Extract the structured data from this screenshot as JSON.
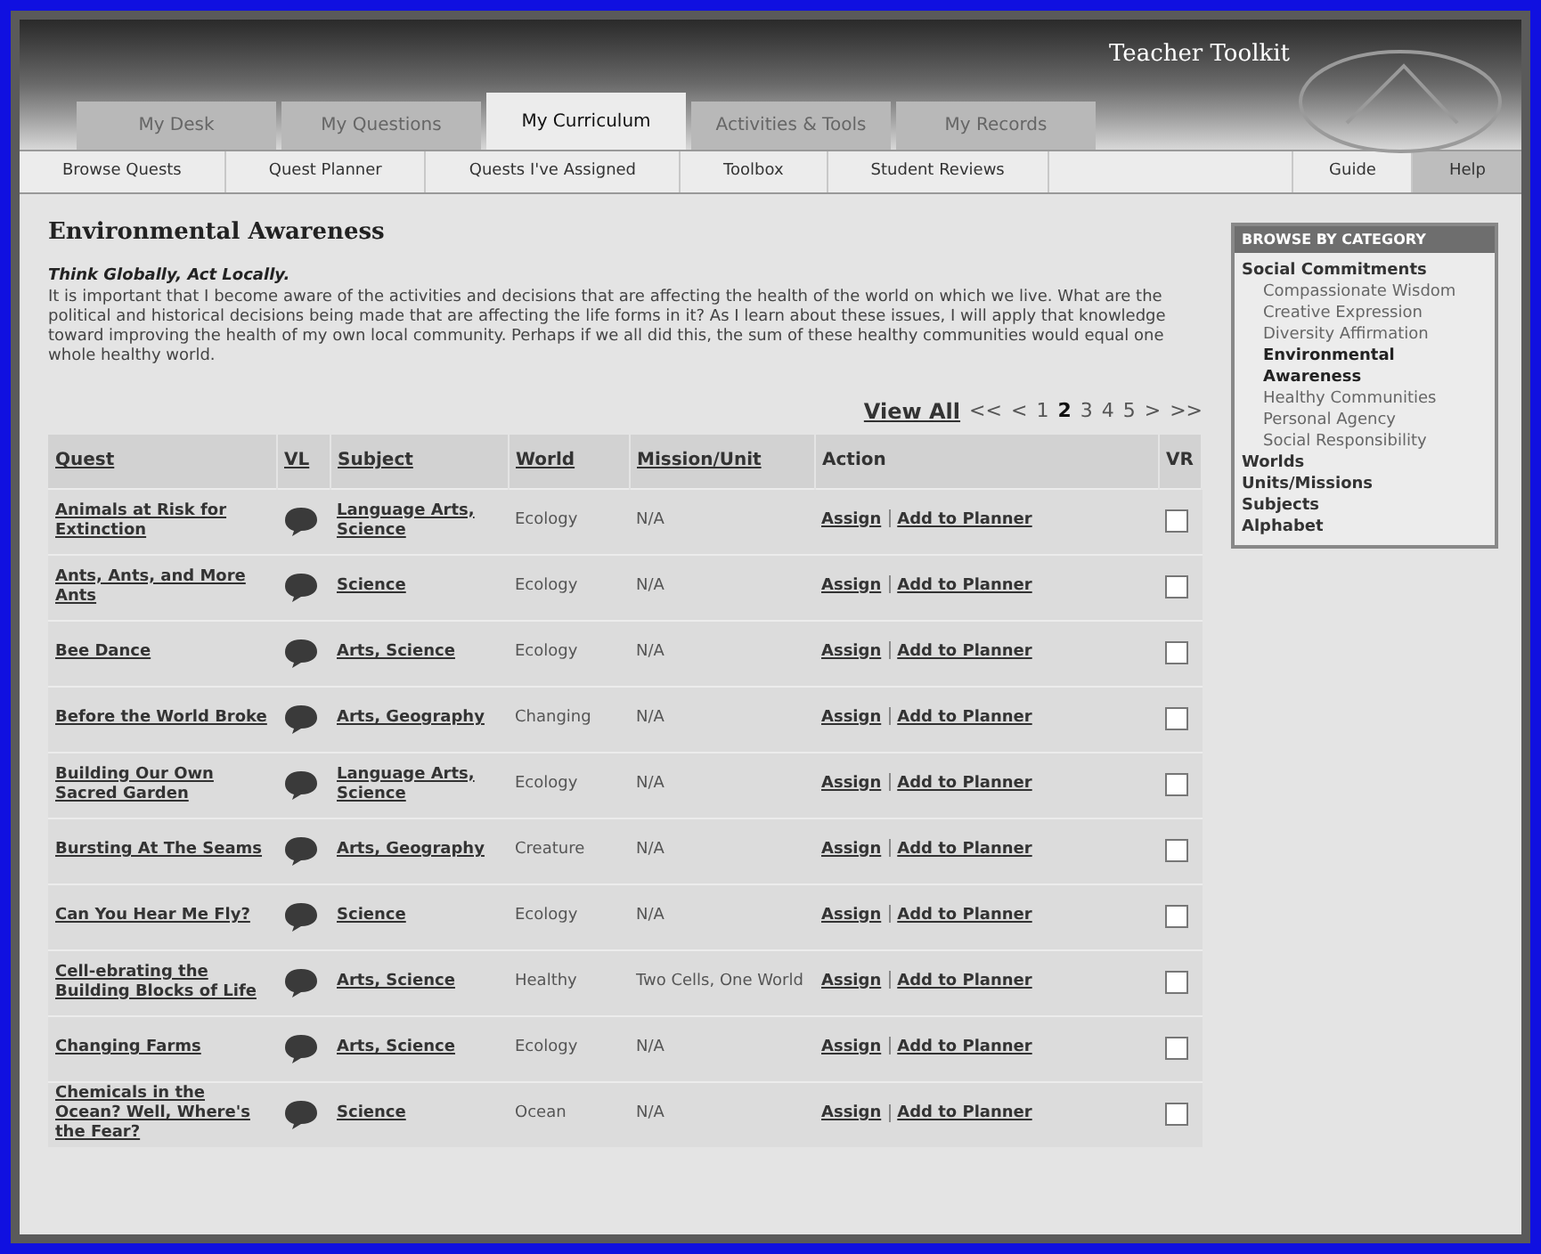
{
  "header": {
    "title": "Teacher Toolkit"
  },
  "tabs": [
    {
      "label": "My Desk",
      "selected": false
    },
    {
      "label": "My Questions",
      "selected": false
    },
    {
      "label": "My Curriculum",
      "selected": true
    },
    {
      "label": "Activities & Tools",
      "selected": false
    },
    {
      "label": "My Records",
      "selected": false
    }
  ],
  "subnav": {
    "left": [
      "Browse Quests",
      "Quest Planner",
      "Quests I've Assigned",
      "Toolbox",
      "Student Reviews"
    ],
    "right": [
      {
        "label": "Guide",
        "selected": false
      },
      {
        "label": "Help",
        "selected": true
      }
    ]
  },
  "page": {
    "title": "Environmental Awareness",
    "motto": "Think Globally, Act Locally.",
    "description": "It is important that I become aware of the activities and decisions that are affecting the health of the world on which we live. What are the political and historical decisions being made that are affecting the life forms in it? As I learn about these issues, I will apply that knowledge toward improving the health of my own local community. Perhaps if we all did this, the sum of these healthy communities would equal one whole healthy world."
  },
  "pagination": {
    "view_all": "View All",
    "first": "<<",
    "prev": "<",
    "pages": [
      {
        "label": "1",
        "selected": false
      },
      {
        "label": "2",
        "selected": true
      },
      {
        "label": "3",
        "selected": false
      },
      {
        "label": "4",
        "selected": false
      },
      {
        "label": "5",
        "selected": false
      }
    ],
    "next": ">",
    "last": ">>"
  },
  "table": {
    "columns": [
      "Quest",
      "VL",
      "Subject",
      "World",
      "Mission/Unit",
      "Action",
      "VR"
    ],
    "rows": [
      {
        "quest": "Animals at Risk for Extinction",
        "subject": "Language Arts, Science",
        "world": "Ecology",
        "mission": "N/A",
        "assign": "Assign",
        "add": "Add to Planner",
        "checked": false
      },
      {
        "quest": "Ants, Ants, and More Ants",
        "subject": "Science",
        "world": "Ecology",
        "mission": "N/A",
        "assign": "Assign",
        "add": "Add to Planner",
        "checked": false
      },
      {
        "quest": "Bee Dance",
        "subject": "Arts, Science",
        "world": "Ecology",
        "mission": "N/A",
        "assign": "Assign",
        "add": "Add to Planner",
        "checked": false
      },
      {
        "quest": "Before the World Broke",
        "subject": "Arts, Geography",
        "world": "Changing",
        "mission": "N/A",
        "assign": "Assign",
        "add": "Add to Planner",
        "checked": false
      },
      {
        "quest": "Building Our Own Sacred Garden",
        "subject": "Language Arts, Science",
        "world": "Ecology",
        "mission": "N/A",
        "assign": "Assign",
        "add": "Add to Planner",
        "checked": false
      },
      {
        "quest": "Bursting At The Seams",
        "subject": "Arts, Geography",
        "world": "Creature",
        "mission": "N/A",
        "assign": "Assign",
        "add": "Add to Planner",
        "checked": false
      },
      {
        "quest": "Can You Hear Me Fly?",
        "subject": "Science",
        "world": "Ecology",
        "mission": "N/A",
        "assign": "Assign",
        "add": "Add to Planner",
        "checked": false
      },
      {
        "quest": "Cell-ebrating the Building Blocks of Life",
        "subject": "Arts, Science",
        "world": "Healthy",
        "mission": "Two Cells, One World",
        "assign": "Assign",
        "add": "Add to Planner",
        "checked": false
      },
      {
        "quest": "Changing Farms",
        "subject": "Arts, Science",
        "world": "Ecology",
        "mission": "N/A",
        "assign": "Assign",
        "add": "Add to Planner",
        "checked": false
      },
      {
        "quest": "Chemicals in the Ocean? Well, Where's the Fear?",
        "subject": "Science",
        "world": "Ocean",
        "mission": "N/A",
        "assign": "Assign",
        "add": "Add to Planner",
        "checked": false
      }
    ]
  },
  "sidebar": {
    "title": "BROWSE BY CATEGORY",
    "group": "Social Commitments",
    "items": [
      {
        "label": "Compassionate Wisdom",
        "selected": false
      },
      {
        "label": "Creative Expression",
        "selected": false
      },
      {
        "label": "Diversity Affirmation",
        "selected": false
      },
      {
        "label": "Environmental Awareness",
        "selected": true
      },
      {
        "label": "Healthy Communities",
        "selected": false
      },
      {
        "label": "Personal Agency",
        "selected": false
      },
      {
        "label": "Social Responsibility",
        "selected": false
      }
    ],
    "links": [
      "Worlds",
      "Units/Missions",
      "Subjects",
      "Alphabet"
    ]
  }
}
